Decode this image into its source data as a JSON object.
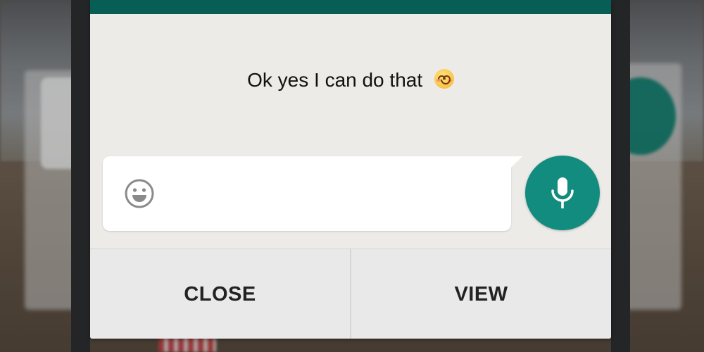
{
  "notification": {
    "message": "Ok yes I can do that",
    "message_emoji": "smiling-face-emoji"
  },
  "composer": {
    "text_value": "",
    "placeholder": "",
    "emoji_button_icon": "emoji-face-icon",
    "mic_button_icon": "microphone-icon"
  },
  "actions": {
    "close_label": "CLOSE",
    "view_label": "VIEW"
  },
  "colors": {
    "header": "#075e54",
    "accent": "#128c7e",
    "popup_background": "#ecebe7",
    "action_bar": "#e9e9e9"
  }
}
